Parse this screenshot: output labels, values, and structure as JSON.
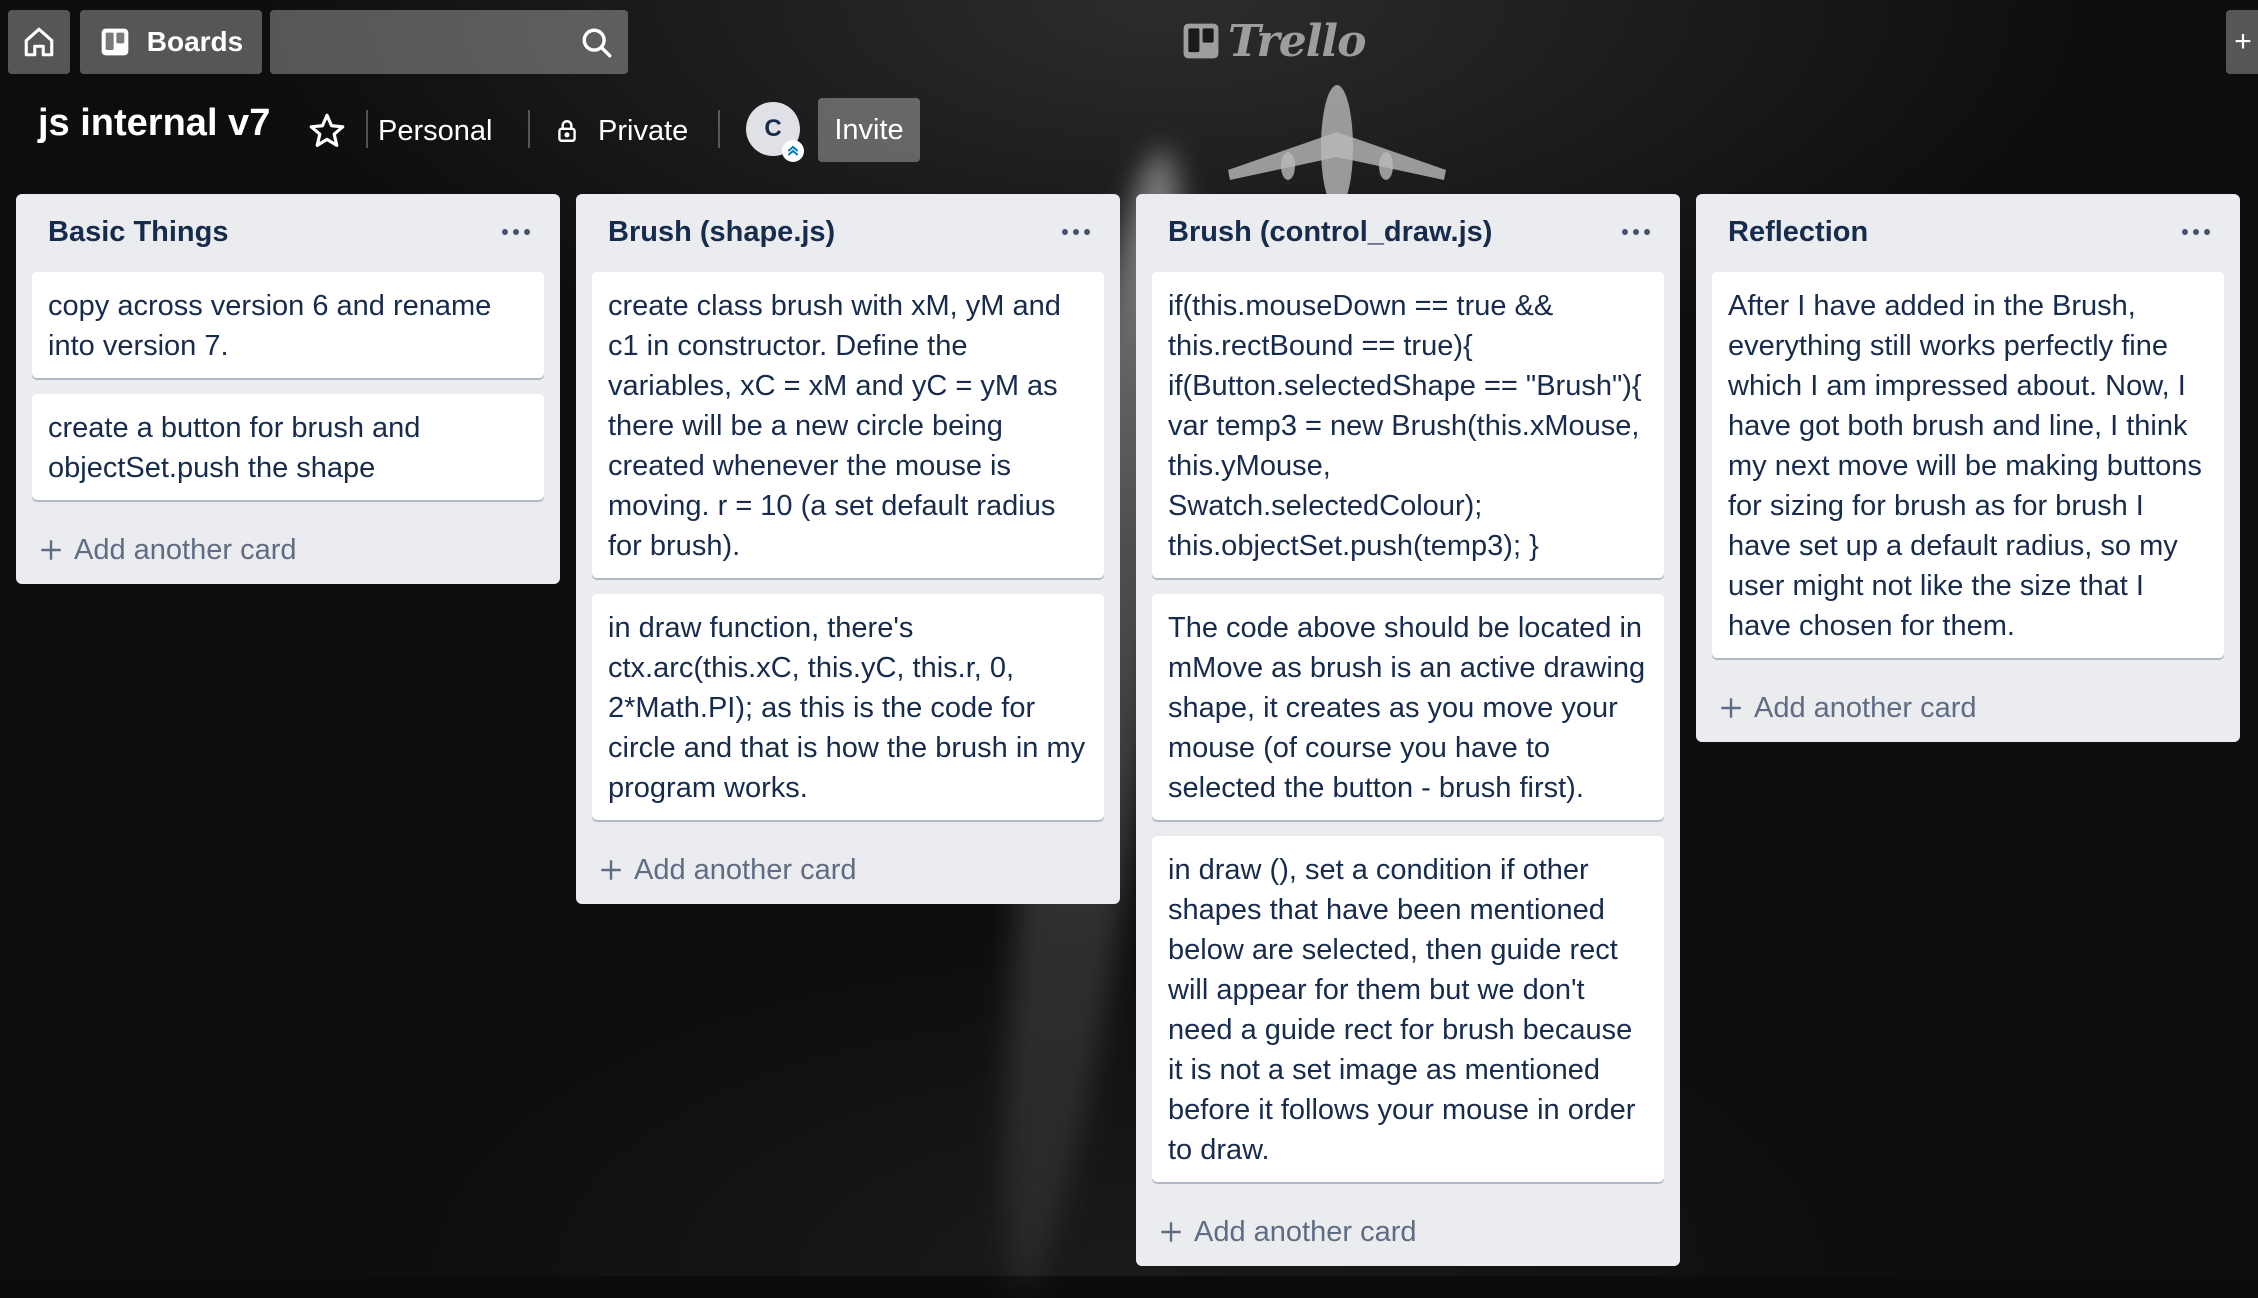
{
  "header": {
    "boards_label": "Boards",
    "search_placeholder": "",
    "logo_text": "Trello"
  },
  "board": {
    "title": "js internal v7",
    "visibility_team": "Personal",
    "privacy": "Private",
    "member_initial": "C",
    "invite_label": "Invite"
  },
  "lists": [
    {
      "title": "Basic Things",
      "cards": [
        "copy across version 6 and rename into version 7.",
        "create a button for brush and objectSet.push the shape"
      ],
      "add_card_label": "Add another card"
    },
    {
      "title": "Brush (shape.js)",
      "cards": [
        "create class brush with xM, yM and c1 in constructor. Define the variables, xC = xM and yC = yM as there will be a new circle being created whenever the mouse is moving. r = 10 (a set default radius for brush).",
        "in draw function, there's ctx.arc(this.xC, this.yC, this.r, 0, 2*Math.PI); as this is the code for circle and that is how the brush in my program works."
      ],
      "add_card_label": "Add another card"
    },
    {
      "title": "Brush (control_draw.js)",
      "cards": [
        "if(this.mouseDown == true && this.rectBound == true){ if(Button.selectedShape == \"Brush\"){ var temp3 = new Brush(this.xMouse, this.yMouse, Swatch.selectedColour); this.objectSet.push(temp3); }",
        "The code above should be located in mMove as brush is an active drawing shape, it creates as you move your mouse (of course you have to selected the button - brush first).",
        "in draw (), set a condition if other shapes that have been mentioned below are selected, then guide rect will appear for them but we don't need a guide rect for brush because it is not a set image as mentioned before it follows your mouse in order to draw."
      ],
      "add_card_label": "Add another card"
    },
    {
      "title": "Reflection",
      "cards": [
        "After I have added in the Brush, everything still works perfectly fine which I am impressed about. Now, I have got both brush and line, I think my next move will be making buttons for sizing for brush as for brush I have set up a default radius, so my user might not like the size that I have chosen for them."
      ],
      "add_card_label": "Add another card"
    }
  ]
}
